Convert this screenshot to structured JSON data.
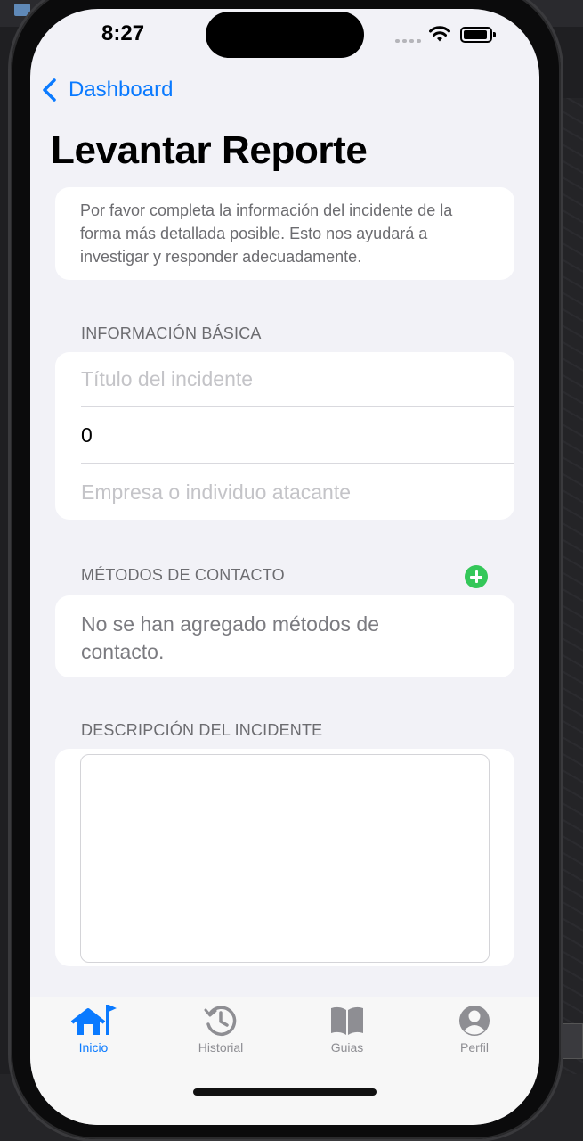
{
  "status": {
    "time": "8:27"
  },
  "nav": {
    "back_label": "Dashboard",
    "title": "Levantar Reporte"
  },
  "intro": {
    "text": "Por favor completa la información del incidente de la forma más detallada posible. Esto nos ayudará a investigar y responder adecuadamente."
  },
  "basic_info": {
    "header": "INFORMACIÓN BÁSICA",
    "title_placeholder": "Título del incidente",
    "amount_value": "0",
    "attacker_placeholder": "Empresa o individuo atacante"
  },
  "contact_methods": {
    "header": "MÉTODOS DE CONTACTO",
    "empty_text": "No se han agregado métodos de contacto.",
    "add_icon": "plus-circle-icon",
    "add_color": "#34c759"
  },
  "description": {
    "header": "DESCRIPCIÓN DEL INCIDENTE",
    "value": ""
  },
  "tabs": [
    {
      "label": "Inicio",
      "icon": "house-flag-icon",
      "active": true
    },
    {
      "label": "Historial",
      "icon": "clock-history-icon",
      "active": false
    },
    {
      "label": "Guias",
      "icon": "book-icon",
      "active": false
    },
    {
      "label": "Perfil",
      "icon": "person-circle-icon",
      "active": false
    }
  ],
  "colors": {
    "accent": "#0a7aff",
    "background": "#f2f2f7",
    "inactive": "#8e8e93"
  }
}
